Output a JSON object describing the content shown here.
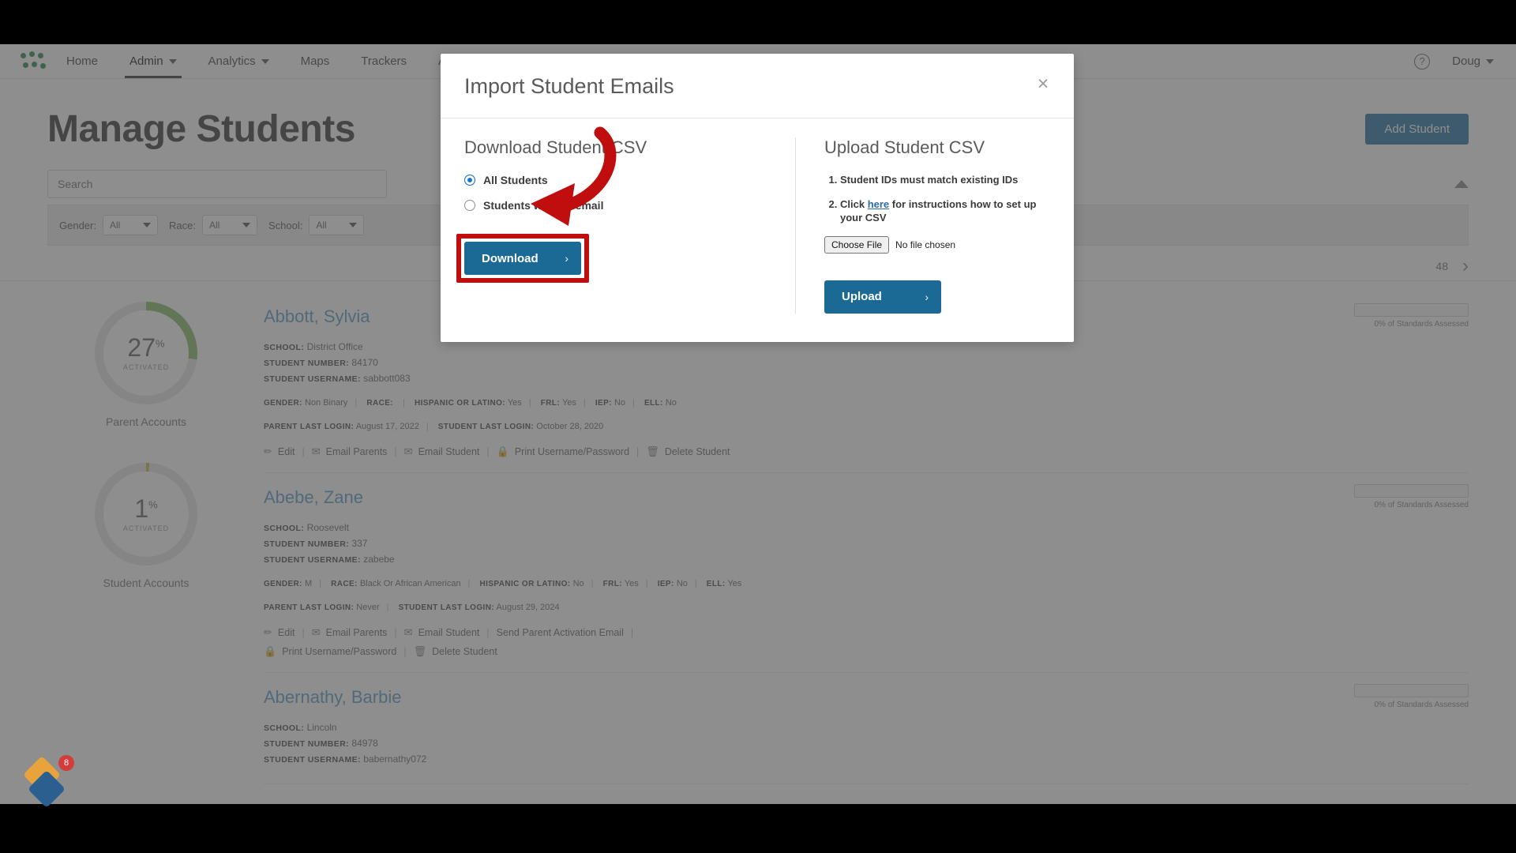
{
  "nav": {
    "logo_name": "app-logo",
    "items": [
      {
        "label": "Home",
        "has_caret": false,
        "active": false
      },
      {
        "label": "Admin",
        "has_caret": true,
        "active": true
      },
      {
        "label": "Analytics",
        "has_caret": true,
        "active": false
      },
      {
        "label": "Maps",
        "has_caret": false,
        "active": false
      },
      {
        "label": "Trackers",
        "has_caret": false,
        "active": false
      },
      {
        "label": "A",
        "has_caret": false,
        "active": false
      }
    ],
    "help_glyph": "?",
    "user_label": "Doug"
  },
  "page": {
    "title": "Manage Students",
    "add_student_label": "Add Student",
    "search_placeholder": "Search",
    "chips": [
      {
        "label": "Gender:",
        "value": "All"
      },
      {
        "label": "Race:",
        "value": "All"
      },
      {
        "label": "School:",
        "value": "All"
      }
    ],
    "pager": {
      "count": "48",
      "next_glyph": "›"
    }
  },
  "stats": [
    {
      "value": "27",
      "unit": "%",
      "sub": "ACTIVATED",
      "label": "Parent Accounts",
      "percent": 27,
      "color": "#8dbd6e"
    },
    {
      "value": "1",
      "unit": "%",
      "sub": "ACTIVATED",
      "label": "Student Accounts",
      "percent": 1,
      "color": "#c9c040"
    }
  ],
  "students": [
    {
      "name": "Abbott, Sylvia",
      "standards_label": "0% of Standards Assessed",
      "school_key": "SCHOOL:",
      "school": "District Office",
      "number_key": "STUDENT NUMBER:",
      "number": "84170",
      "username_key": "STUDENT USERNAME:",
      "username": "sabbott083",
      "demographics": [
        {
          "key": "GENDER:",
          "value": "Non Binary"
        },
        {
          "key": "RACE:",
          "value": ""
        },
        {
          "key": "HISPANIC OR LATINO:",
          "value": "Yes"
        },
        {
          "key": "FRL:",
          "value": "Yes"
        },
        {
          "key": "IEP:",
          "value": "No"
        },
        {
          "key": "ELL:",
          "value": "No"
        }
      ],
      "logins": [
        {
          "key": "PARENT LAST LOGIN:",
          "value": "August 17, 2022"
        },
        {
          "key": "STUDENT LAST LOGIN:",
          "value": "October 28, 2020"
        }
      ],
      "actions": [
        "Edit",
        "Email Parents",
        "Email Student",
        "Print Username/Password",
        "Delete Student"
      ]
    },
    {
      "name": "Abebe, Zane",
      "standards_label": "0% of Standards Assessed",
      "school_key": "SCHOOL:",
      "school": "Roosevelt",
      "number_key": "STUDENT NUMBER:",
      "number": "337",
      "username_key": "STUDENT USERNAME:",
      "username": "zabebe",
      "demographics": [
        {
          "key": "GENDER:",
          "value": "M"
        },
        {
          "key": "RACE:",
          "value": "Black Or African American"
        },
        {
          "key": "HISPANIC OR LATINO:",
          "value": "No"
        },
        {
          "key": "FRL:",
          "value": "Yes"
        },
        {
          "key": "IEP:",
          "value": "No"
        },
        {
          "key": "ELL:",
          "value": "Yes"
        }
      ],
      "logins": [
        {
          "key": "PARENT LAST LOGIN:",
          "value": "Never"
        },
        {
          "key": "STUDENT LAST LOGIN:",
          "value": "August 29, 2024"
        }
      ],
      "actions": [
        "Edit",
        "Email Parents",
        "Email Student",
        "Send Parent Activation Email",
        "Print Username/Password",
        "Delete Student"
      ]
    },
    {
      "name": "Abernathy, Barbie",
      "standards_label": "0% of Standards Assessed",
      "school_key": "SCHOOL:",
      "school": "Lincoln",
      "number_key": "STUDENT NUMBER:",
      "number": "84978",
      "username_key": "STUDENT USERNAME:",
      "username": "babernathy072",
      "demographics": [],
      "logins": [],
      "actions": []
    }
  ],
  "fab": {
    "badge": "8",
    "name": "help-widget"
  },
  "modal": {
    "title": "Import Student Emails",
    "close_glyph": "×",
    "download": {
      "section_title": "Download Student CSV",
      "options": [
        {
          "label": "All Students",
          "selected": true
        },
        {
          "label": "Students with no email",
          "selected": false
        }
      ],
      "button_label": "Download",
      "button_chevron": "›"
    },
    "upload": {
      "section_title": "Upload Student CSV",
      "steps": [
        {
          "text_before": "Student IDs must match existing IDs",
          "link": "",
          "text_after": ""
        },
        {
          "text_before": "Click ",
          "link": "here",
          "text_after": " for instructions how to set up your CSV"
        }
      ],
      "choose_file_label": "Choose File",
      "file_status": "No file chosen",
      "button_label": "Upload",
      "button_chevron": "›"
    }
  },
  "annotation": {
    "arrow_color": "#c00d0d",
    "highlight_color": "#c00d0d"
  }
}
